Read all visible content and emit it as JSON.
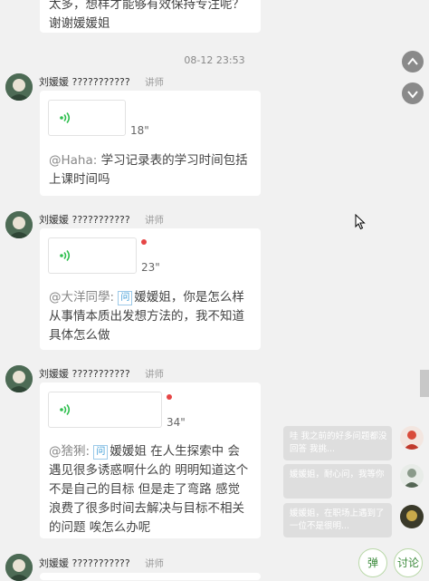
{
  "top_card": {
    "text": "太多，想样才能够有效保持专注呢？谢谢媛媛姐"
  },
  "timestamp": "08-12 23:53",
  "messages": [
    {
      "sender": "刘媛媛",
      "sender_suffix": "???????????",
      "role": "讲师",
      "duration": "18\"",
      "unread": false,
      "mention": "@Haha:",
      "has_quote_tag": false,
      "text": "学习记录表的学习时间包括上课时间吗"
    },
    {
      "sender": "刘媛媛",
      "sender_suffix": "???????????",
      "role": "讲师",
      "duration": "23\"",
      "unread": true,
      "mention": "@大洋同學:",
      "has_quote_tag": true,
      "text": "媛媛姐，你是怎么样从事情本质出发想方法的，我不知道具体怎么做"
    },
    {
      "sender": "刘媛媛",
      "sender_suffix": "???????????",
      "role": "讲师",
      "duration": "34\"",
      "unread": true,
      "mention": "@猞猁:",
      "has_quote_tag": true,
      "text": "媛媛姐 在人生探索中 会遇见很多诱惑啊什么的 明明知道这个不是自己的目标 但是走了弯路 感觉浪费了很多时间去解决与目标不相关的问题 唉怎么办呢"
    },
    {
      "sender": "刘媛媛",
      "sender_suffix": "???????????",
      "role": "讲师"
    }
  ],
  "quote_tag": "问",
  "barrage": [
    {
      "text": "哇 我之前的好多问题都没回答 我挑..."
    },
    {
      "text": "媛媛姐，耐心问，我等你"
    },
    {
      "text": "媛媛姐，在职场上遇到了一位不是很明..."
    }
  ],
  "buttons": {
    "barrage": "弹",
    "discuss": "讨论"
  },
  "colors": {
    "background": "#f1f1f1",
    "voice_icon": "#2fbf4f",
    "unread_dot": "#e64545",
    "role": "#999999"
  },
  "icons": [
    "chevron-up-icon",
    "chevron-down-icon",
    "voice-wave-icon",
    "cursor-icon"
  ]
}
